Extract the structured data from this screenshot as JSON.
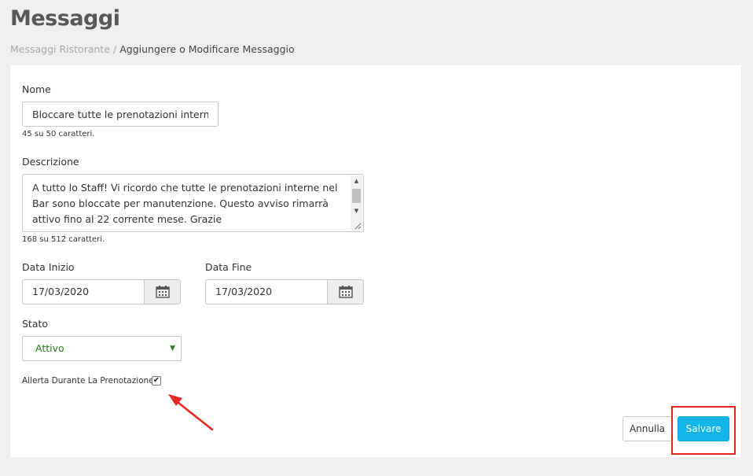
{
  "page": {
    "title": "Messaggi"
  },
  "breadcrumb": {
    "parent": "Messaggi Ristorante",
    "separator": "/",
    "current": "Aggiungere o Modificare Messaggio"
  },
  "form": {
    "name": {
      "label": "Nome",
      "value": "Bloccare tutte le prenotazioni interne i",
      "counter": "45 su 50 caratteri."
    },
    "description": {
      "label": "Descrizione",
      "value": "A tutto lo Staff! Vi ricordo che tutte le prenotazioni interne nel Bar sono bloccate per manutenzione. Questo avviso rimarrà attivo fino al 22 corrente mese. Grazie",
      "counter": "168 su 512 caratteri."
    },
    "start_date": {
      "label": "Data Inizio",
      "value": "17/03/2020",
      "icon": "calendar-icon"
    },
    "end_date": {
      "label": "Data Fine",
      "value": "17/03/2020",
      "icon": "calendar-icon"
    },
    "status": {
      "label": "Stato",
      "value": "Attivo",
      "color": "#2a7a1e"
    },
    "alert": {
      "label": "Allerta Durante La Prenotazione",
      "checked": true
    }
  },
  "actions": {
    "cancel_label": "Annulla",
    "save_label": "Salvare"
  },
  "colors": {
    "accent": "#13b4e8",
    "annotation": "#e8241c",
    "background": "#efefef"
  }
}
